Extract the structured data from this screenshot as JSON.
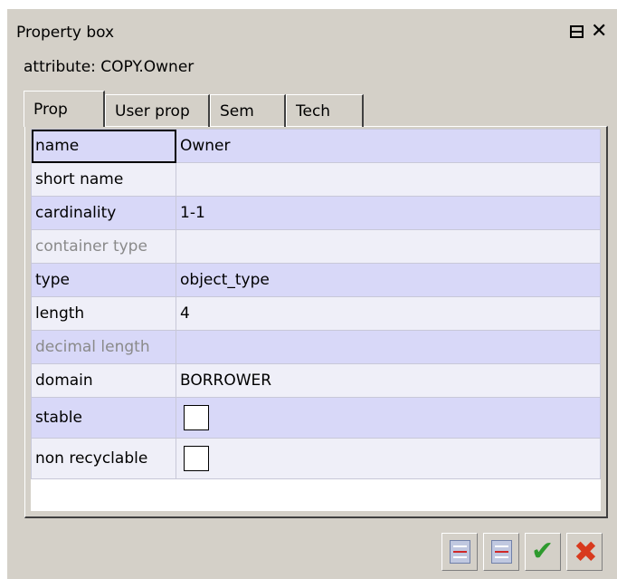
{
  "window": {
    "title": "Property box",
    "float_icon": "float-window-icon",
    "close_icon": "close-icon",
    "close_glyph": "✕"
  },
  "attribute_line": "attribute: COPY.Owner",
  "tabs": [
    {
      "label": "Prop",
      "active": true
    },
    {
      "label": "User prop",
      "active": false
    },
    {
      "label": "Sem",
      "active": false
    },
    {
      "label": "Tech",
      "active": false
    }
  ],
  "properties": [
    {
      "key": "name",
      "value": "Owner",
      "disabled": false
    },
    {
      "key": "short name",
      "value": "",
      "disabled": false
    },
    {
      "key": "cardinality",
      "value": "1-1",
      "disabled": false
    },
    {
      "key": "container type",
      "value": "",
      "disabled": true
    },
    {
      "key": "type",
      "value": "object_type",
      "disabled": false
    },
    {
      "key": "length",
      "value": "4",
      "disabled": false
    },
    {
      "key": "decimal length",
      "value": "",
      "disabled": true
    },
    {
      "key": "domain",
      "value": "BORROWER",
      "disabled": false
    },
    {
      "key": "stable",
      "checkbox": true,
      "checked": false
    },
    {
      "key": "non recyclable",
      "checkbox": true,
      "checked": false
    }
  ],
  "buttons": [
    {
      "icon": "document-icon"
    },
    {
      "icon": "document-icon"
    },
    {
      "icon": "checkmark-icon",
      "glyph": "✔"
    },
    {
      "icon": "cancel-x-icon",
      "glyph": "✖"
    }
  ],
  "colors": {
    "panel_bg": "#d4d0c8",
    "row_odd": "#d8d8f8",
    "row_even": "#efeff8",
    "ok_green": "#2e9a2e",
    "cancel_red": "#d83a1e"
  }
}
